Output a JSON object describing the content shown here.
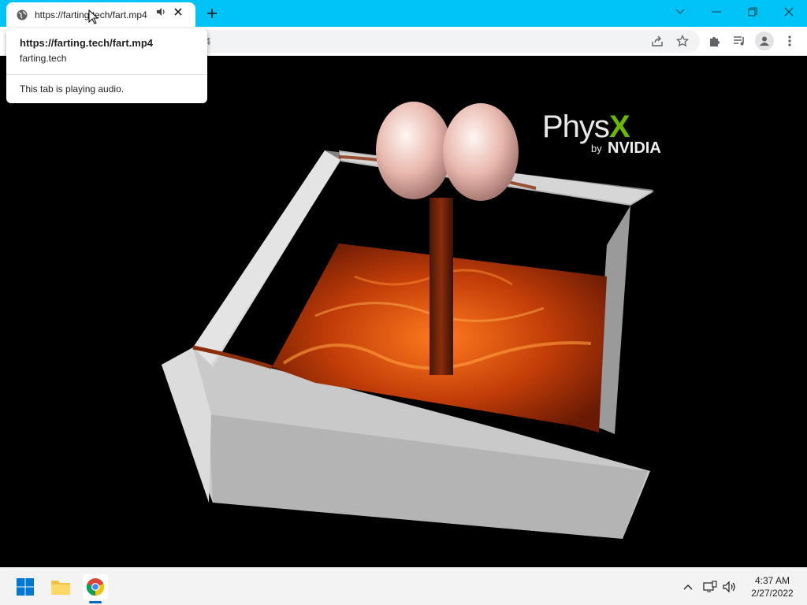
{
  "browser": {
    "tab": {
      "title": "https://farting.tech/fart.mp4",
      "favicon": "globe-icon",
      "audio_icon": "speaker-icon",
      "close_icon": "close-icon"
    },
    "new_tab_icon": "plus-icon",
    "window_controls": [
      "chevron-down-icon",
      "minimize-icon",
      "restore-icon",
      "close-icon"
    ],
    "omnibox": {
      "text_visible_fragment": "4"
    },
    "toolbar_icons": [
      "share-icon",
      "star-icon",
      "extensions-icon",
      "media-control-icon",
      "profile-icon",
      "menu-icon"
    ],
    "accent_color": "#00c3f5"
  },
  "hovercard": {
    "title": "https://farting.tech/fart.mp4",
    "domain": "farting.tech",
    "status": "This tab is playing audio."
  },
  "video": {
    "logo_word": "Phys",
    "logo_x": "X",
    "logo_by": "by",
    "logo_brand": "NVIDIA"
  },
  "taskbar": {
    "apps": [
      "windows-start-icon",
      "file-explorer-icon",
      "chrome-icon"
    ],
    "tray": [
      "chevron-up-icon",
      "network-icon",
      "volume-icon"
    ],
    "time": "4:37 AM",
    "date": "2/27/2022"
  }
}
